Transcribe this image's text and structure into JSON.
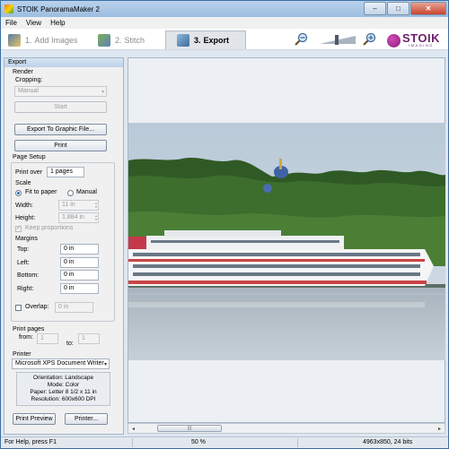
{
  "window": {
    "title": "STOIK PanoramaMaker 2",
    "minimize": "–",
    "maximize": "□",
    "close": "✕"
  },
  "menu": [
    "File",
    "View",
    "Help"
  ],
  "toolbar": {
    "steps": [
      {
        "num": "1.",
        "label": "Add Images"
      },
      {
        "num": "2.",
        "label": "Stitch"
      },
      {
        "num": "3.",
        "label": "Export"
      }
    ],
    "active_step": "3. Export",
    "logo": {
      "name": "STOIK",
      "sub": "IMAGING"
    }
  },
  "panel": {
    "header": "Export",
    "render": {
      "heading": "Render",
      "cropping_label": "Cropping:",
      "cropping_value": "Manual",
      "start_label": "Start"
    },
    "export_label": "Export To Graphic File...",
    "print_label": "Print",
    "page_setup": {
      "heading": "Page Setup",
      "print_over_label": "Print over",
      "print_over_value": "1 pages",
      "scale": {
        "heading": "Scale",
        "fit_label": "Fit to paper",
        "manual_label": "Manual",
        "width_label": "Width:",
        "width_value": "11 in",
        "height_label": "Height:",
        "height_value": "1.884 in",
        "keep_label": "Keep proportions"
      },
      "margins": {
        "heading": "Margins",
        "top_label": "Top:",
        "top_value": "0 in",
        "left_label": "Left:",
        "left_value": "0 in",
        "bottom_label": "Bottom:",
        "bottom_value": "0 in",
        "right_label": "Right:",
        "right_value": "0 in"
      },
      "overlap_label": "Overlap:",
      "overlap_value": "0 in"
    },
    "print_pages": {
      "heading": "Print pages",
      "from_label": "from:",
      "from_value": "1",
      "to_label": "to:",
      "to_value": "1"
    },
    "printer": {
      "heading": "Printer",
      "selected": "Microsoft XPS Document Writer",
      "info": {
        "orientation": "Orientation: Landscape",
        "mode": "Mode: Color",
        "paper": "Paper: Letter 8 1/2 x 11 in",
        "resolution": "Resolution: 600x600 DPI"
      },
      "preview_label": "Print Preview",
      "printer_label": "Printer..."
    }
  },
  "scrollbar": {
    "thumb_grip": "|||",
    "left_arrow": "◂",
    "right_arrow": "▸"
  },
  "status": {
    "help": "For Help, press F1",
    "zoom": "50 %",
    "info": "4963x850, 24 bits"
  },
  "colors": {
    "accent": "#3b6fa3",
    "logo": "#6b1f6a"
  }
}
